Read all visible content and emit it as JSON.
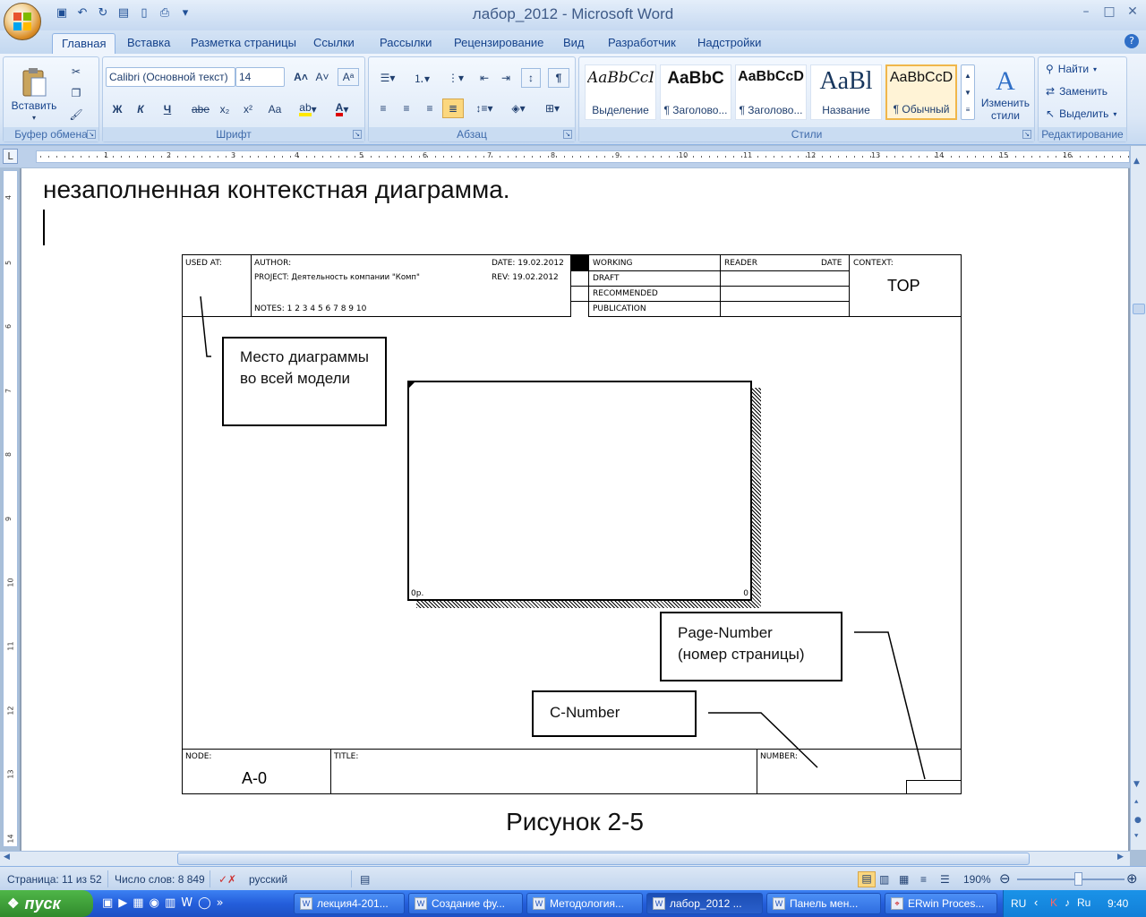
{
  "window": {
    "title": "лабор_2012 - Microsoft Word",
    "min": "–",
    "max": "□",
    "close": "✕"
  },
  "tabs": [
    "Главная",
    "Вставка",
    "Разметка страницы",
    "Ссылки",
    "Рассылки",
    "Рецензирование",
    "Вид",
    "Разработчик",
    "Надстройки"
  ],
  "ribbon": {
    "clipboard": {
      "label": "Буфер обмена",
      "paste": "Вставить"
    },
    "font": {
      "label": "Шрифт",
      "name": "Calibri (Основной текст)",
      "size": "14",
      "bold": "Ж",
      "italic": "К",
      "underline": "Ч",
      "strike": "abe",
      "sub": "x₂",
      "sup": "x²",
      "case": "Aa"
    },
    "paragraph": {
      "label": "Абзац"
    },
    "styles": {
      "label": "Стили",
      "items": [
        {
          "sample": "AaBbCcI",
          "name": "Выделение"
        },
        {
          "sample": "AaBbC",
          "name": "¶ Заголово..."
        },
        {
          "sample": "AaBbCcD",
          "name": "¶ Заголово..."
        },
        {
          "sample": "AaBl",
          "name": "Название"
        },
        {
          "sample": "AaBbCcD",
          "name": "¶ Обычный"
        }
      ],
      "change": "Изменить стили"
    },
    "editing": {
      "label": "Редактирование",
      "find": "Найти",
      "replace": "Заменить",
      "select": "Выделить"
    }
  },
  "ruler": {
    "h": [
      "1",
      "1",
      "2",
      "3",
      "4",
      "5",
      "6",
      "7",
      "8",
      "9",
      "10",
      "11",
      "12",
      "13",
      "14",
      "15",
      "16"
    ],
    "v": [
      "4",
      "5",
      "6",
      "7",
      "8",
      "9",
      "10",
      "11",
      "12",
      "13",
      "14"
    ]
  },
  "doc": {
    "heading": "незаполненная контекстная диаграмма.",
    "form": {
      "used_at": "USED AT:",
      "author": "AUTHOR:",
      "project": "PROJECT:  Деятельность компании \"Комп\"",
      "notes": "NOTES:  1  2  3  4  5  6  7  8  9  10",
      "date": "DATE:  19.02.2012",
      "rev": "REV:    19.02.2012",
      "working": "WORKING",
      "draft": "DRAFT",
      "recommended": "RECOMMENDED",
      "publication": "PUBLICATION",
      "reader": "READER",
      "reader_date": "DATE",
      "context": "CONTEXT:",
      "top": "TOP",
      "node": "NODE:",
      "node_val": "A-0",
      "title": "TITLE:",
      "number": "NUMBER:",
      "box_left": "0р.",
      "box_right": "0"
    },
    "callouts": {
      "place": "Место диаграммы во всей модели",
      "page_number_1": "Page-Number",
      "page_number_2": "(номер страницы)",
      "c_number": "C-Number"
    },
    "caption": "Рисунок 2-5"
  },
  "status": {
    "page": "Страница: 11 из 52",
    "words": "Число слов: 8 849",
    "lang": "русский",
    "zoom": "190%"
  },
  "taskbar": {
    "start": "пуск",
    "tasks": [
      "лекция4-201...",
      "Создание фу...",
      "Методология...",
      "лабор_2012 ...",
      "Панель мен...",
      "ERwin Proces..."
    ],
    "lang": "RU",
    "time": "9:40"
  }
}
